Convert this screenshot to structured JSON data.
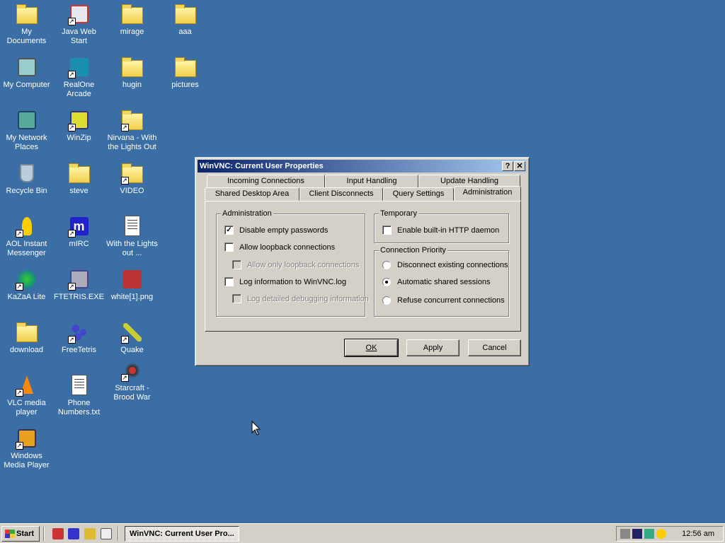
{
  "desktop": {
    "icons": [
      {
        "label": "My Documents"
      },
      {
        "label": "Java Web Start"
      },
      {
        "label": "mirage"
      },
      {
        "label": "aaa"
      },
      {
        "label": "My Computer"
      },
      {
        "label": "RealOne Arcade"
      },
      {
        "label": "hugin"
      },
      {
        "label": "pictures"
      },
      {
        "label": "My Network Places"
      },
      {
        "label": "WinZip"
      },
      {
        "label": "Nirvana - With the Lights Out"
      },
      {
        "label": "Recycle Bin"
      },
      {
        "label": "steve"
      },
      {
        "label": "VIDEO"
      },
      {
        "label": "AOL Instant Messenger"
      },
      {
        "label": "mIRC"
      },
      {
        "label": "With the Lights out ..."
      },
      {
        "label": "KaZaA Lite"
      },
      {
        "label": "FTETRIS.EXE"
      },
      {
        "label": "white[1].png"
      },
      {
        "label": "download"
      },
      {
        "label": "FreeTetris"
      },
      {
        "label": "Quake"
      },
      {
        "label": "Starcraft - Brood War"
      },
      {
        "label": "VLC media player"
      },
      {
        "label": "Phone Numbers.txt"
      },
      {
        "label": "Windows Media Player"
      }
    ]
  },
  "dialog": {
    "title": "WinVNC: Current User Properties",
    "help_glyph": "?",
    "close_glyph": "✕",
    "tabs_back": [
      "Incoming Connections",
      "Input Handling",
      "Update Handling"
    ],
    "tabs_front": [
      "Shared Desktop Area",
      "Client Disconnects",
      "Query Settings",
      "Administration"
    ],
    "active_tab": "Administration",
    "admin_group": {
      "label": "Administration",
      "options": [
        {
          "label": "Disable empty passwords",
          "checked": true,
          "disabled": false
        },
        {
          "label": "Allow loopback connections",
          "checked": false,
          "disabled": false
        },
        {
          "label": "Allow only loopback connections",
          "checked": false,
          "disabled": true
        },
        {
          "label": "Log information to WinVNC.log",
          "checked": false,
          "disabled": false
        },
        {
          "label": "Log detailed debugging information",
          "checked": false,
          "disabled": true
        }
      ]
    },
    "temporary_group": {
      "label": "Temporary",
      "options": [
        {
          "label": "Enable built-in HTTP daemon",
          "checked": false
        }
      ]
    },
    "priority_group": {
      "label": "Connection Priority",
      "options": [
        {
          "label": "Disconnect existing connections",
          "selected": false
        },
        {
          "label": "Automatic shared sessions",
          "selected": true
        },
        {
          "label": "Refuse concurrent connections",
          "selected": false
        }
      ]
    },
    "buttons": {
      "ok": "OK",
      "apply": "Apply",
      "cancel": "Cancel"
    }
  },
  "taskbar": {
    "start_label": "Start",
    "task_label": "WinVNC: Current User Pro...",
    "clock": "12:56 am"
  }
}
